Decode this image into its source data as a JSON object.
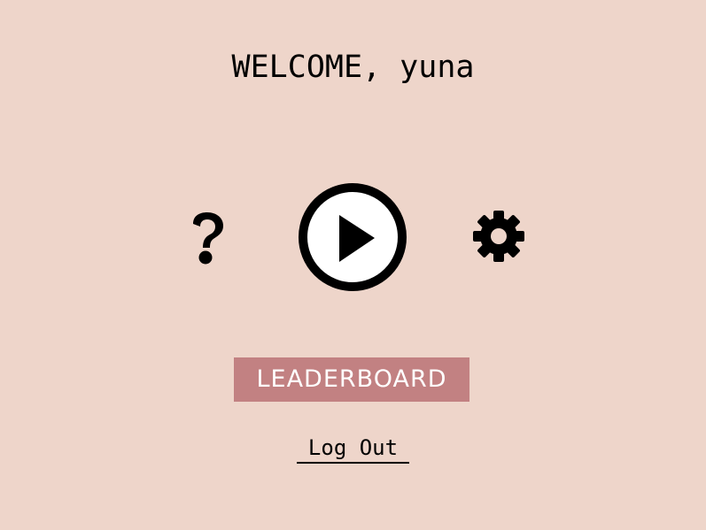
{
  "header": {
    "welcome_text": "WELCOME, yuna"
  },
  "menu": {
    "help_icon": "question-mark",
    "play_icon": "play-circle",
    "settings_icon": "gear",
    "leaderboard_label": "LEADERBOARD",
    "logout_label": "Log Out"
  },
  "colors": {
    "background": "#eed5ca",
    "leaderboard_button": "#c28182",
    "leaderboard_text": "#ffffff",
    "foreground": "#000000"
  }
}
